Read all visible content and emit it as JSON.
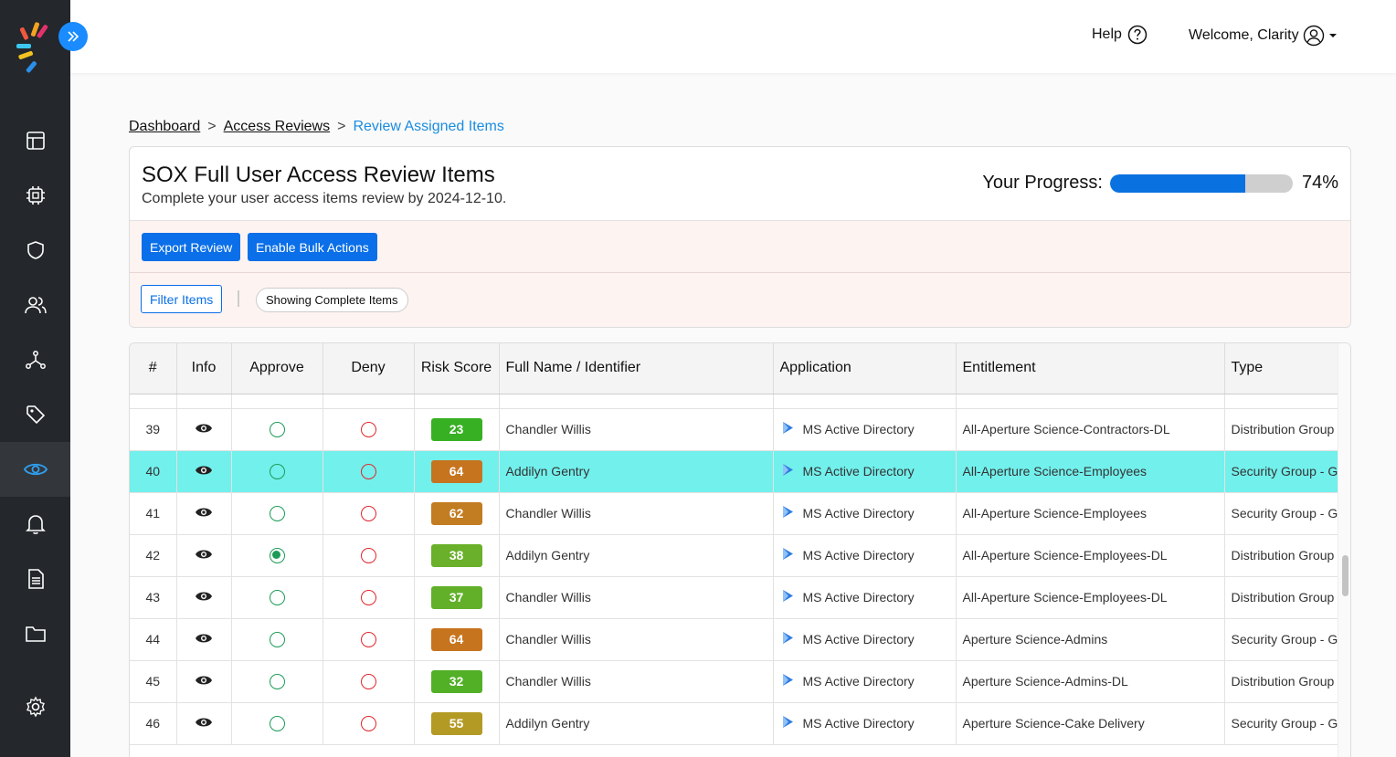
{
  "header": {
    "help_label": "Help",
    "welcome_label": "Welcome, Clarity"
  },
  "sidebar": {
    "items": [
      {
        "name": "layout-icon"
      },
      {
        "name": "chip-icon"
      },
      {
        "name": "shield-icon"
      },
      {
        "name": "users-icon"
      },
      {
        "name": "network-icon"
      },
      {
        "name": "tag-icon"
      },
      {
        "name": "eye-icon",
        "active": true
      },
      {
        "name": "bell-icon"
      },
      {
        "name": "document-icon"
      },
      {
        "name": "folder-icon"
      },
      {
        "name": "gear-icon"
      }
    ]
  },
  "breadcrumb": {
    "items": [
      "Dashboard",
      "Access Reviews"
    ],
    "current": "Review Assigned Items",
    "separator": ">"
  },
  "review": {
    "title": "SOX Full User Access Review Items",
    "subtitle": "Complete your user access items review by 2024-12-10.",
    "progress_label": "Your Progress:",
    "progress_value": 0.74,
    "progress_text": "74%",
    "export_label": "Export Review",
    "bulk_label": "Enable Bulk Actions",
    "filter_label": "Filter Items",
    "showing_label": "Showing Complete Items"
  },
  "table": {
    "columns": [
      "#",
      "Info",
      "Approve",
      "Deny",
      "Risk Score",
      "Full Name / Identifier",
      "Application",
      "Entitlement",
      "Type"
    ],
    "rows": [
      {
        "num": "39",
        "approved": false,
        "risk": "23",
        "risk_color": "#37b023",
        "name": "Chandler Willis",
        "app": "MS Active Directory",
        "entitlement": "All-Aperture Science-Contractors-DL",
        "type": "Distribution Group"
      },
      {
        "num": "40",
        "approved": false,
        "risk": "64",
        "risk_color": "#c7741f",
        "name": "Addilyn Gentry",
        "app": "MS Active Directory",
        "entitlement": "All-Aperture Science-Employees",
        "type": "Security Group - Global",
        "highlight": true
      },
      {
        "num": "41",
        "approved": false,
        "risk": "62",
        "risk_color": "#c27c22",
        "name": "Chandler Willis",
        "app": "MS Active Directory",
        "entitlement": "All-Aperture Science-Employees",
        "type": "Security Group - Global"
      },
      {
        "num": "42",
        "approved": true,
        "risk": "38",
        "risk_color": "#6ab02a",
        "name": "Addilyn Gentry",
        "app": "MS Active Directory",
        "entitlement": "All-Aperture Science-Employees-DL",
        "type": "Distribution Group"
      },
      {
        "num": "43",
        "approved": false,
        "risk": "37",
        "risk_color": "#62b02a",
        "name": "Chandler Willis",
        "app": "MS Active Directory",
        "entitlement": "All-Aperture Science-Employees-DL",
        "type": "Distribution Group"
      },
      {
        "num": "44",
        "approved": false,
        "risk": "64",
        "risk_color": "#c7741f",
        "name": "Chandler Willis",
        "app": "MS Active Directory",
        "entitlement": "Aperture Science-Admins",
        "type": "Security Group - Global"
      },
      {
        "num": "45",
        "approved": false,
        "risk": "32",
        "risk_color": "#52b027",
        "name": "Chandler Willis",
        "app": "MS Active Directory",
        "entitlement": "Aperture Science-Admins-DL",
        "type": "Distribution Group"
      },
      {
        "num": "46",
        "approved": false,
        "risk": "55",
        "risk_color": "#b39a24",
        "name": "Addilyn Gentry",
        "app": "MS Active Directory",
        "entitlement": "Aperture Science-Cake Delivery",
        "type": "Security Group - Global"
      }
    ]
  },
  "colors": {
    "accent": "#0a6fe8",
    "sidebar_bg": "#24272b",
    "highlight_row": "#72f0ec",
    "approve": "#1b9b57",
    "deny": "#e0262c"
  }
}
